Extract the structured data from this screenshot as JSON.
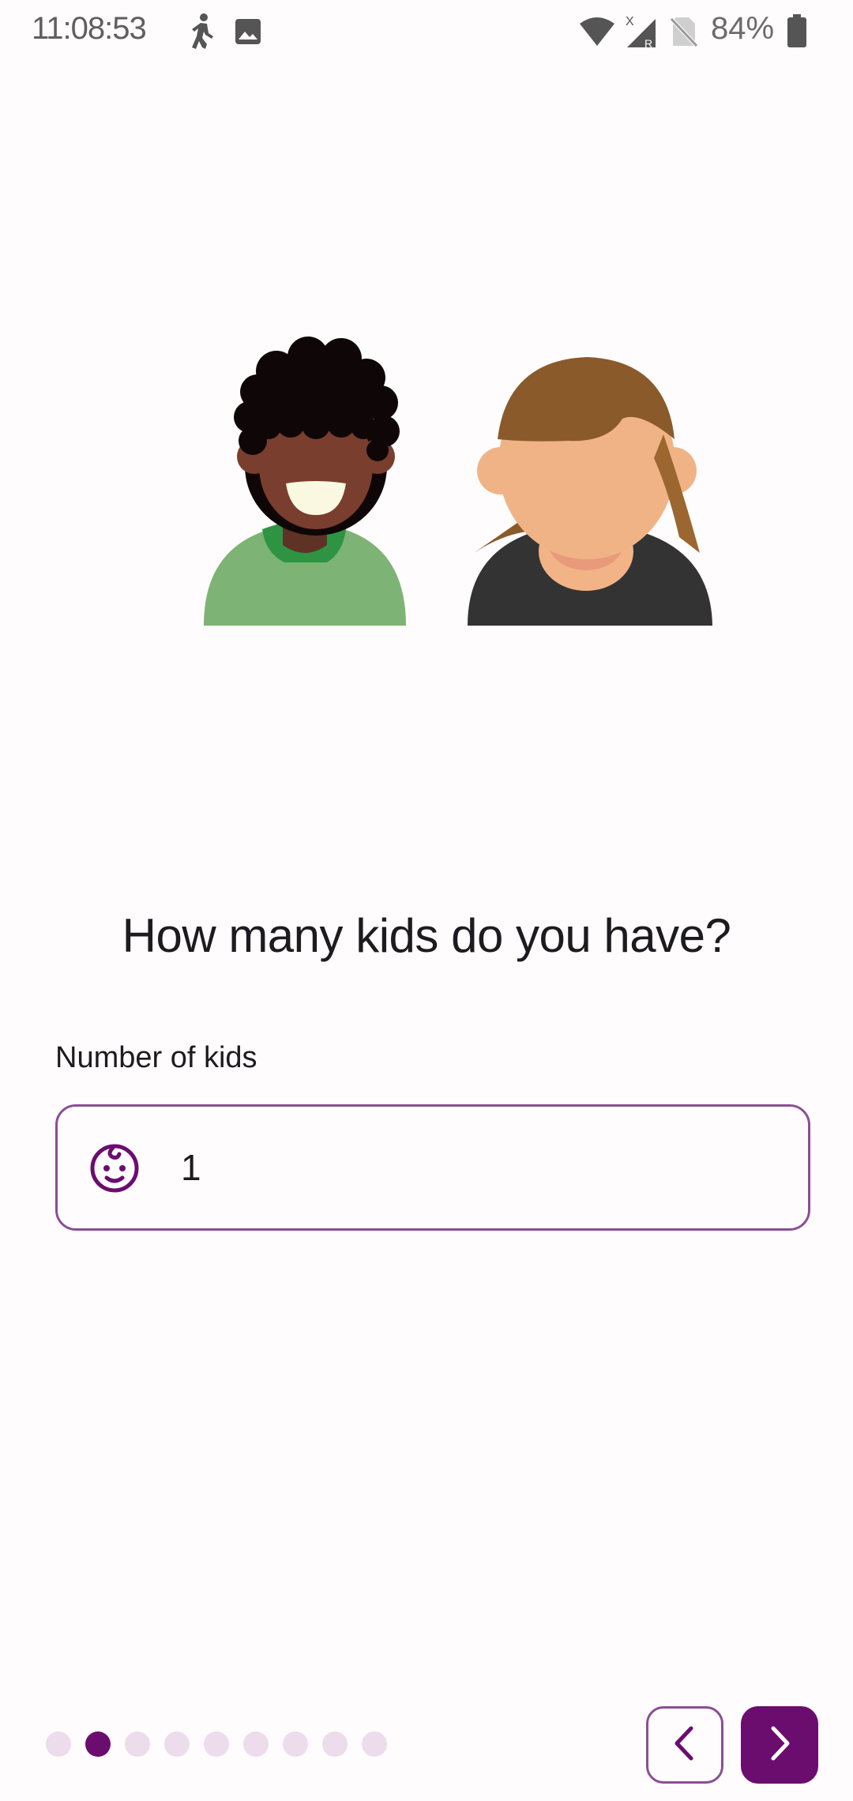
{
  "status_bar": {
    "time": "11:08:53",
    "left_icons": [
      "walking-person-icon",
      "image-icon"
    ],
    "right_icons": [
      "wifi-icon",
      "signal-icon",
      "no-sim-icon",
      "battery-icon"
    ],
    "battery_percent": "84%"
  },
  "illustration": {
    "figures": [
      "child-avatar",
      "adult-avatar"
    ]
  },
  "onboarding": {
    "question": "How many kids do you have?",
    "field_label": "Number of kids",
    "field_icon": "baby-face-icon",
    "field_value": "1"
  },
  "pager": {
    "total_steps": 9,
    "current_step": 2
  },
  "navigation": {
    "prev_icon": "chevron-left-icon",
    "next_icon": "chevron-right-icon"
  },
  "colors": {
    "accent": "#6b0d6f",
    "outline": "#8a4f93",
    "dot_inactive": "#eddceb",
    "background": "#fffcfd"
  }
}
